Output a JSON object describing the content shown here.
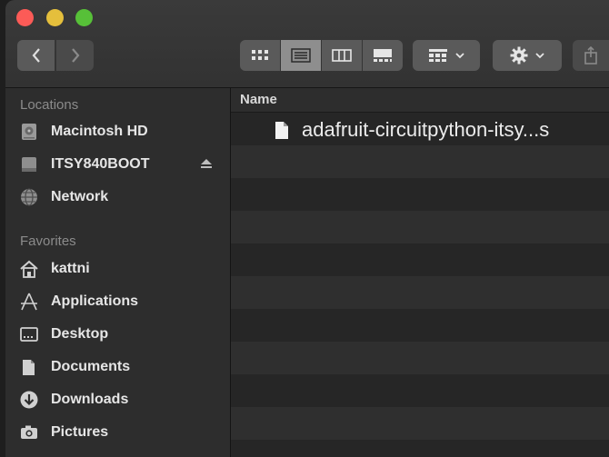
{
  "toolbar": {
    "back_icon": "chevron-left-icon",
    "forward_icon": "chevron-right-icon",
    "views": [
      "icon-view-icon",
      "list-view-icon",
      "column-view-icon",
      "gallery-view-icon"
    ],
    "group_icon": "group-grid-icon",
    "action_icon": "gear-icon",
    "share_icon": "share-icon"
  },
  "sidebar": {
    "locations_title": "Locations",
    "favorites_title": "Favorites",
    "locations": [
      {
        "label": "Macintosh HD",
        "icon": "hard-drive-icon"
      },
      {
        "label": "ITSY840BOOT",
        "icon": "external-drive-icon"
      },
      {
        "label": "Network",
        "icon": "globe-icon"
      }
    ],
    "favorites": [
      {
        "label": "kattni",
        "icon": "home-icon"
      },
      {
        "label": "Applications",
        "icon": "applications-icon"
      },
      {
        "label": "Desktop",
        "icon": "desktop-icon"
      },
      {
        "label": "Documents",
        "icon": "documents-icon"
      },
      {
        "label": "Downloads",
        "icon": "downloads-icon"
      },
      {
        "label": "Pictures",
        "icon": "camera-icon"
      }
    ]
  },
  "content": {
    "column_name": "Name",
    "files": [
      {
        "name": "adafruit-circuitpython-itsy...s",
        "icon": "document-icon"
      }
    ]
  },
  "colors": {
    "close": "#fc5b57",
    "minimize": "#e5bf3c",
    "zoom": "#57c038"
  }
}
